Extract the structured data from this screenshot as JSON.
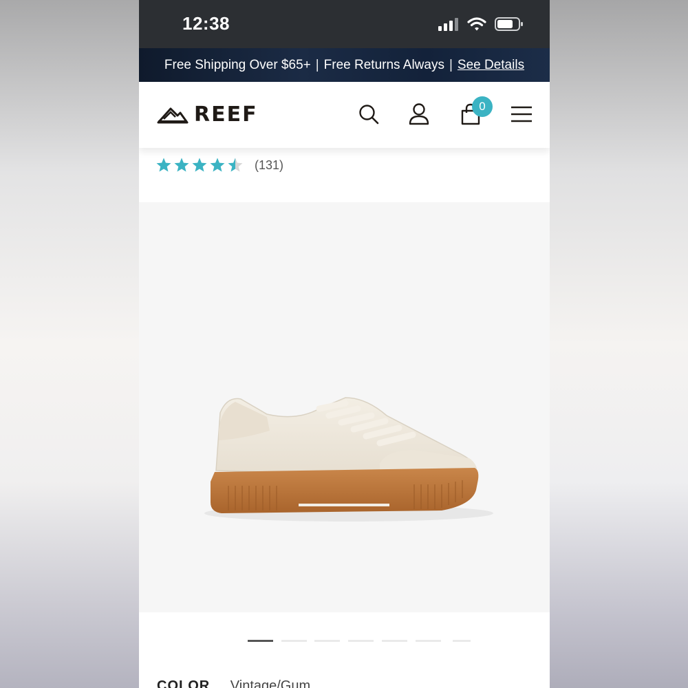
{
  "status_bar": {
    "time": "12:38"
  },
  "promo": {
    "shipping": "Free Shipping Over $65+",
    "returns": "Free Returns Always",
    "details_link": "See Details"
  },
  "header": {
    "brand": "REEF",
    "cart_count": "0"
  },
  "product": {
    "rating_value": 4.5,
    "review_count": "(131)",
    "color_label": "COLOR",
    "color_value": "Vintage/Gum"
  },
  "carousel": {
    "total_images": 7,
    "active_index": 0
  },
  "colors": {
    "accent": "#3bb3c3",
    "status_bar": "#2c2f33",
    "promo_bar": "#13223a"
  },
  "icons": [
    "signal-icon",
    "wifi-icon",
    "battery-icon",
    "reef-logo-icon",
    "search-icon",
    "account-icon",
    "cart-icon",
    "menu-icon",
    "star-icon"
  ]
}
